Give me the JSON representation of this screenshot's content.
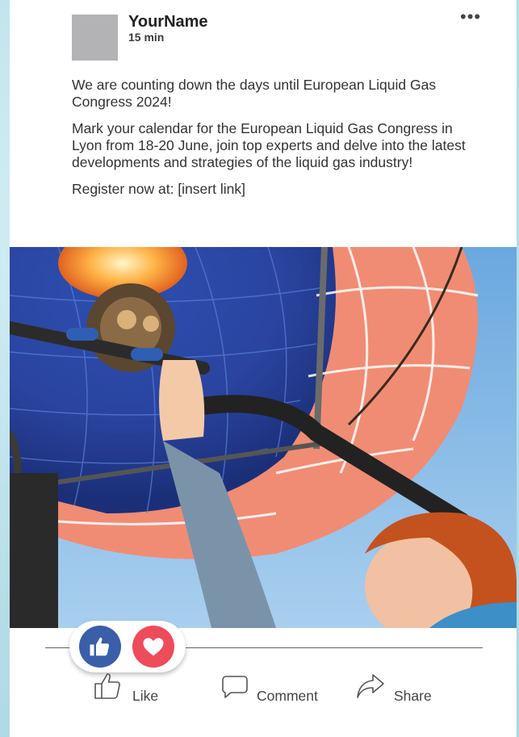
{
  "post": {
    "author": "YourName",
    "time": "15 min",
    "paragraphs": [
      "We are counting down the days until European Liquid Gas Congress 2024!",
      "Mark your calendar for the European Liquid Gas Congress in Lyon from 18-20 June, join top experts and delve into the latest developments and strategies of the liquid gas industry!",
      "Register now at: [insert link]"
    ],
    "more_icon": "more-horizontal-icon"
  },
  "reactions": {
    "like_icon": "thumbs-up-icon",
    "love_icon": "heart-icon",
    "like_color": "#3a5fa8",
    "love_color": "#ee4b5b"
  },
  "actions": {
    "like_label": "Like",
    "comment_label": "Comment",
    "share_label": "Share"
  }
}
